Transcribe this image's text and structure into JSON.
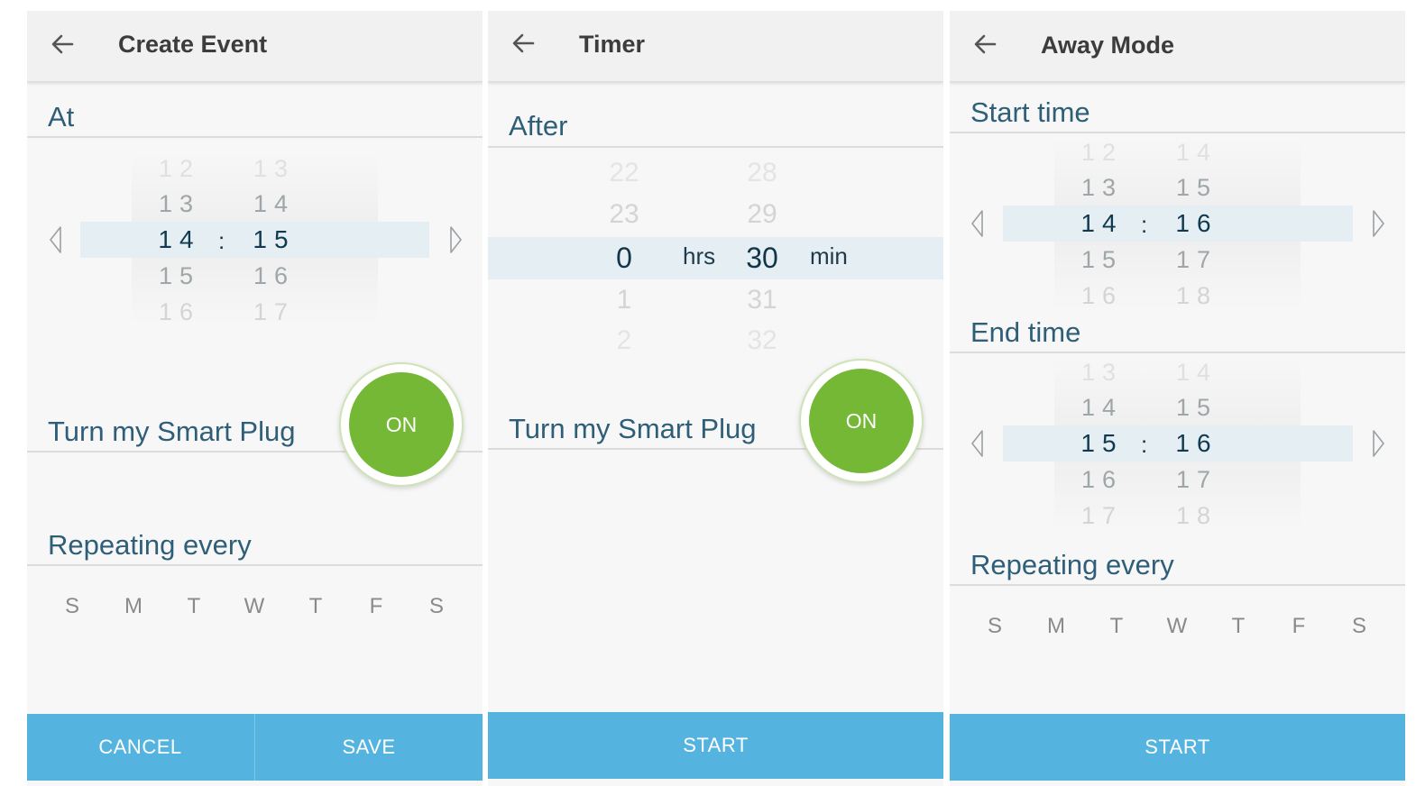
{
  "colors": {
    "accent": "#55b4df",
    "toggle_on": "#74b836",
    "section_text": "#2f5f78",
    "highlight_row": "#e5eef3"
  },
  "icons": {
    "back": "arrow-left-icon",
    "prev": "triangle-left-icon",
    "next": "triangle-right-icon"
  },
  "create_event": {
    "title": "Create Event",
    "at_label": "At",
    "hours": [
      "12",
      "13",
      "14",
      "15",
      "16"
    ],
    "minutes": [
      "13",
      "14",
      "15",
      "16",
      "17"
    ],
    "colon": ":",
    "plug_label": "Turn my Smart Plug",
    "toggle": "ON",
    "repeat_label": "Repeating every",
    "days": [
      "S",
      "M",
      "T",
      "W",
      "T",
      "F",
      "S"
    ],
    "cancel": "CANCEL",
    "save": "SAVE"
  },
  "timer": {
    "title": "Timer",
    "after_label": "After",
    "hours": [
      "22",
      "23",
      "0",
      "1",
      "2"
    ],
    "minutes": [
      "28",
      "29",
      "30",
      "31",
      "32"
    ],
    "hrs_unit": "hrs",
    "min_unit": "min",
    "plug_label": "Turn my Smart Plug",
    "toggle": "ON",
    "start": "START"
  },
  "away_mode": {
    "title": "Away Mode",
    "start_label": "Start time",
    "start_hours": [
      "12",
      "13",
      "14",
      "15",
      "16"
    ],
    "start_minutes": [
      "14",
      "15",
      "16",
      "17",
      "18"
    ],
    "end_label": "End time",
    "end_hours": [
      "13",
      "14",
      "15",
      "16",
      "17"
    ],
    "end_minutes": [
      "14",
      "15",
      "16",
      "17",
      "18"
    ],
    "colon": ":",
    "repeat_label": "Repeating every",
    "days": [
      "S",
      "M",
      "T",
      "W",
      "T",
      "F",
      "S"
    ],
    "start": "START"
  }
}
